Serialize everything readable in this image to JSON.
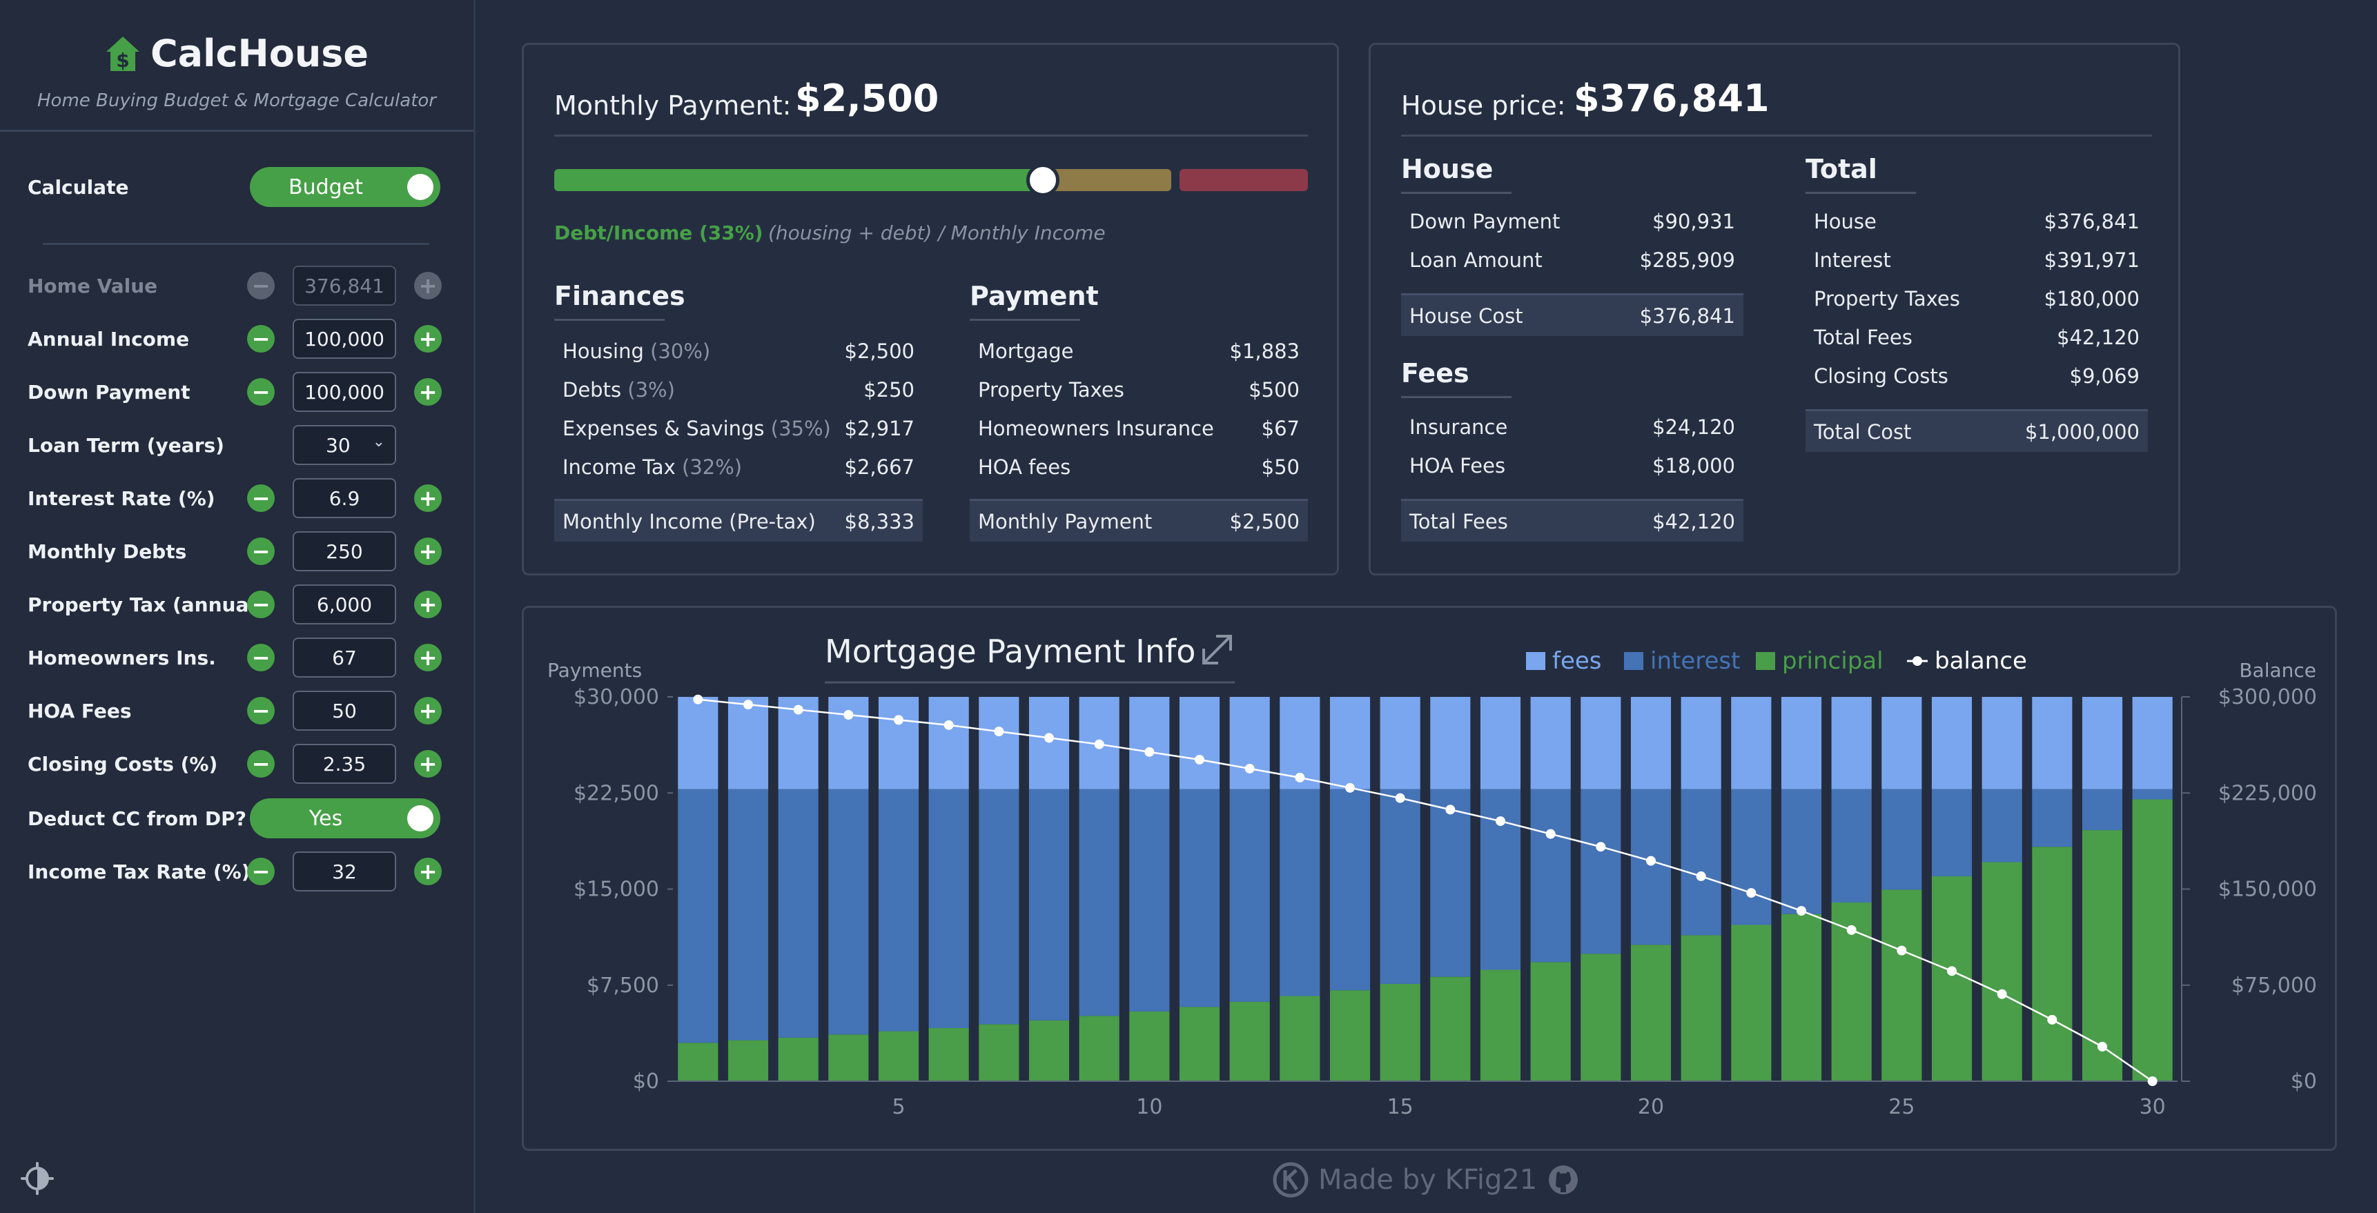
{
  "app": {
    "name": "CalcHouse",
    "subtitle": "Home Buying Budget & Mortgage Calculator",
    "footer": "Made by KFig21"
  },
  "sidebar": {
    "calculate": {
      "label": "Calculate",
      "toggle": "Budget"
    },
    "fields": [
      {
        "label": "Home Value",
        "value": "376,841",
        "disabled": true
      },
      {
        "label": "Annual Income",
        "value": "100,000"
      },
      {
        "label": "Down Payment",
        "value": "100,000"
      },
      {
        "label": "Loan Term (years)",
        "value": "30",
        "select": true
      },
      {
        "label": "Interest Rate (%)",
        "value": "6.9"
      },
      {
        "label": "Monthly Debts",
        "value": "250"
      },
      {
        "label": "Property Tax (annual)",
        "value": "6,000"
      },
      {
        "label": "Homeowners Ins.",
        "value": "67"
      },
      {
        "label": "HOA Fees",
        "value": "50"
      },
      {
        "label": "Closing Costs (%)",
        "value": "2.35"
      }
    ],
    "deduct": {
      "label": "Deduct CC from DP?",
      "toggle": "Yes"
    },
    "tax": {
      "label": "Income Tax Rate (%)",
      "value": "32"
    }
  },
  "monthly": {
    "title": "Monthly Payment:",
    "value": "$2,500",
    "dti_label": "Debt/Income (33%)",
    "dti_formula": "(housing + debt) / Monthly Income",
    "dti_fill_fraction": 0.33,
    "finances": {
      "title": "Finances",
      "rows": [
        {
          "label": "Housing",
          "pct": "(30%)",
          "value": "$2,500"
        },
        {
          "label": "Debts",
          "pct": "(3%)",
          "value": "$250"
        },
        {
          "label": "Expenses & Savings",
          "pct": "(35%)",
          "value": "$2,917"
        },
        {
          "label": "Income Tax",
          "pct": "(32%)",
          "value": "$2,667"
        }
      ],
      "total": {
        "label": "Monthly Income (Pre-tax)",
        "value": "$8,333"
      }
    },
    "payment": {
      "title": "Payment",
      "rows": [
        {
          "label": "Mortgage",
          "value": "$1,883"
        },
        {
          "label": "Property Taxes",
          "value": "$500"
        },
        {
          "label": "Homeowners Insurance",
          "value": "$67"
        },
        {
          "label": "HOA fees",
          "value": "$50"
        }
      ],
      "total": {
        "label": "Monthly Payment",
        "value": "$2,500"
      }
    }
  },
  "house": {
    "title": "House price:",
    "value": "$376,841",
    "house_section": {
      "title": "House",
      "rows": [
        {
          "label": "Down Payment",
          "value": "$90,931"
        },
        {
          "label": "Loan Amount",
          "value": "$285,909"
        }
      ],
      "total": {
        "label": "House Cost",
        "value": "$376,841"
      }
    },
    "fees_section": {
      "title": "Fees",
      "rows": [
        {
          "label": "Insurance",
          "value": "$24,120"
        },
        {
          "label": "HOA Fees",
          "value": "$18,000"
        }
      ],
      "total": {
        "label": "Total Fees",
        "value": "$42,120"
      }
    },
    "total_section": {
      "title": "Total",
      "rows": [
        {
          "label": "House",
          "value": "$376,841"
        },
        {
          "label": "Interest",
          "value": "$391,971"
        },
        {
          "label": "Property Taxes",
          "value": "$180,000"
        },
        {
          "label": "Total Fees",
          "value": "$42,120"
        },
        {
          "label": "Closing Costs",
          "value": "$9,069"
        }
      ],
      "total": {
        "label": "Total Cost",
        "value": "$1,000,000"
      }
    }
  },
  "colors": {
    "green": "#46a047",
    "fees": "#7aa6ef",
    "interest": "#4473b6",
    "principal": "#4a9d49",
    "khaki": "#8f7b48",
    "red": "#8c3a4a"
  },
  "chart_data": {
    "type": "bar",
    "title": "Mortgage Payment Info",
    "ylabel": "Payments",
    "y2label": "Balance",
    "legend": [
      "fees",
      "interest",
      "principal",
      "balance"
    ],
    "legend_position": "top-right",
    "ylim": [
      0,
      30000
    ],
    "y2lim": [
      0,
      300000
    ],
    "yticks": [
      "$0",
      "$7,500",
      "$15,000",
      "$22,500",
      "$30,000"
    ],
    "y2ticks": [
      "$0",
      "$75,000",
      "$150,000",
      "$225,000",
      "$300,000"
    ],
    "xticks": [
      "5",
      "10",
      "15",
      "20",
      "25",
      "30"
    ],
    "x": [
      1,
      2,
      3,
      4,
      5,
      6,
      7,
      8,
      9,
      10,
      11,
      12,
      13,
      14,
      15,
      16,
      17,
      18,
      19,
      20,
      21,
      22,
      23,
      24,
      25,
      26,
      27,
      28,
      29,
      30
    ],
    "series": [
      {
        "name": "principal",
        "values": [
          3000,
          3200,
          3400,
          3650,
          3900,
          4150,
          4450,
          4750,
          5100,
          5450,
          5800,
          6200,
          6650,
          7100,
          7600,
          8150,
          8700,
          9300,
          9950,
          10650,
          11400,
          12200,
          13050,
          13950,
          14950,
          16000,
          17100,
          18300,
          19600,
          22000
        ]
      },
      {
        "name": "interest",
        "values": [
          19800,
          19600,
          19400,
          19150,
          18900,
          18650,
          18350,
          18050,
          17700,
          17350,
          17000,
          16600,
          16150,
          15700,
          15200,
          14650,
          14100,
          13500,
          12850,
          12150,
          11400,
          10600,
          9750,
          8850,
          7850,
          6800,
          5700,
          4500,
          3200,
          800
        ]
      },
      {
        "name": "fees",
        "values": [
          7200,
          7200,
          7200,
          7200,
          7200,
          7200,
          7200,
          7200,
          7200,
          7200,
          7200,
          7200,
          7200,
          7200,
          7200,
          7200,
          7200,
          7200,
          7200,
          7200,
          7200,
          7200,
          7200,
          7200,
          7200,
          7200,
          7200,
          7200,
          7200,
          7200
        ]
      },
      {
        "name": "balance",
        "values": [
          298000,
          294000,
          290000,
          286000,
          282000,
          278000,
          273000,
          268000,
          263000,
          257000,
          251000,
          244000,
          237000,
          229000,
          221000,
          212000,
          203000,
          193000,
          183000,
          172000,
          160000,
          147000,
          133000,
          118000,
          102000,
          86000,
          68000,
          48000,
          27000,
          0
        ]
      }
    ]
  }
}
